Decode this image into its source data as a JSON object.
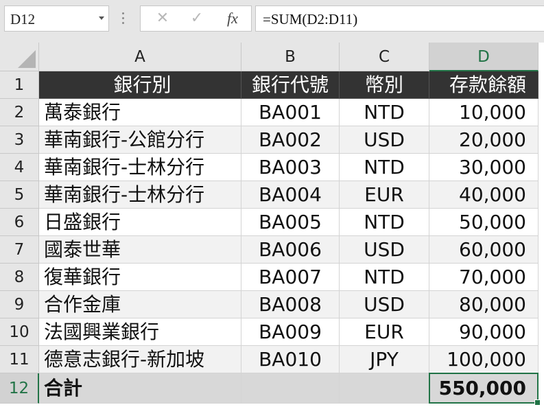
{
  "name_box": "D12",
  "formula": "=SUM(D2:D11)",
  "formula_buttons": [
    "✕",
    "✓",
    "fx"
  ],
  "columns": [
    "A",
    "B",
    "C",
    "D"
  ],
  "selected_column": "D",
  "selected_row": "12",
  "rows": [
    {
      "num": "1",
      "cells": [
        "銀行別",
        "銀行代號",
        "幣別",
        "存款餘額"
      ]
    },
    {
      "num": "2",
      "cells": [
        "萬泰銀行",
        "BA001",
        "NTD",
        "10,000"
      ]
    },
    {
      "num": "3",
      "cells": [
        "華南銀行-公館分行",
        "BA002",
        "USD",
        "20,000"
      ]
    },
    {
      "num": "4",
      "cells": [
        "華南銀行-士林分行",
        "BA003",
        "NTD",
        "30,000"
      ]
    },
    {
      "num": "5",
      "cells": [
        "華南銀行-士林分行",
        "BA004",
        "EUR",
        "40,000"
      ]
    },
    {
      "num": "6",
      "cells": [
        "日盛銀行",
        "BA005",
        "NTD",
        "50,000"
      ]
    },
    {
      "num": "7",
      "cells": [
        "國泰世華",
        "BA006",
        "USD",
        "60,000"
      ]
    },
    {
      "num": "8",
      "cells": [
        "復華銀行",
        "BA007",
        "NTD",
        "70,000"
      ]
    },
    {
      "num": "9",
      "cells": [
        "合作金庫",
        "BA008",
        "USD",
        "80,000"
      ]
    },
    {
      "num": "10",
      "cells": [
        "法國興業銀行",
        "BA009",
        "EUR",
        "90,000"
      ]
    },
    {
      "num": "11",
      "cells": [
        "德意志銀行-新加坡",
        "BA010",
        "JPY",
        "100,000"
      ]
    },
    {
      "num": "12",
      "cells": [
        "合計",
        "",
        "",
        "550,000"
      ]
    }
  ],
  "colors": {
    "accent": "#217346",
    "header_fill": "#333333",
    "band_fill": "#f2f2f2",
    "total_fill": "#d8d8d8"
  }
}
